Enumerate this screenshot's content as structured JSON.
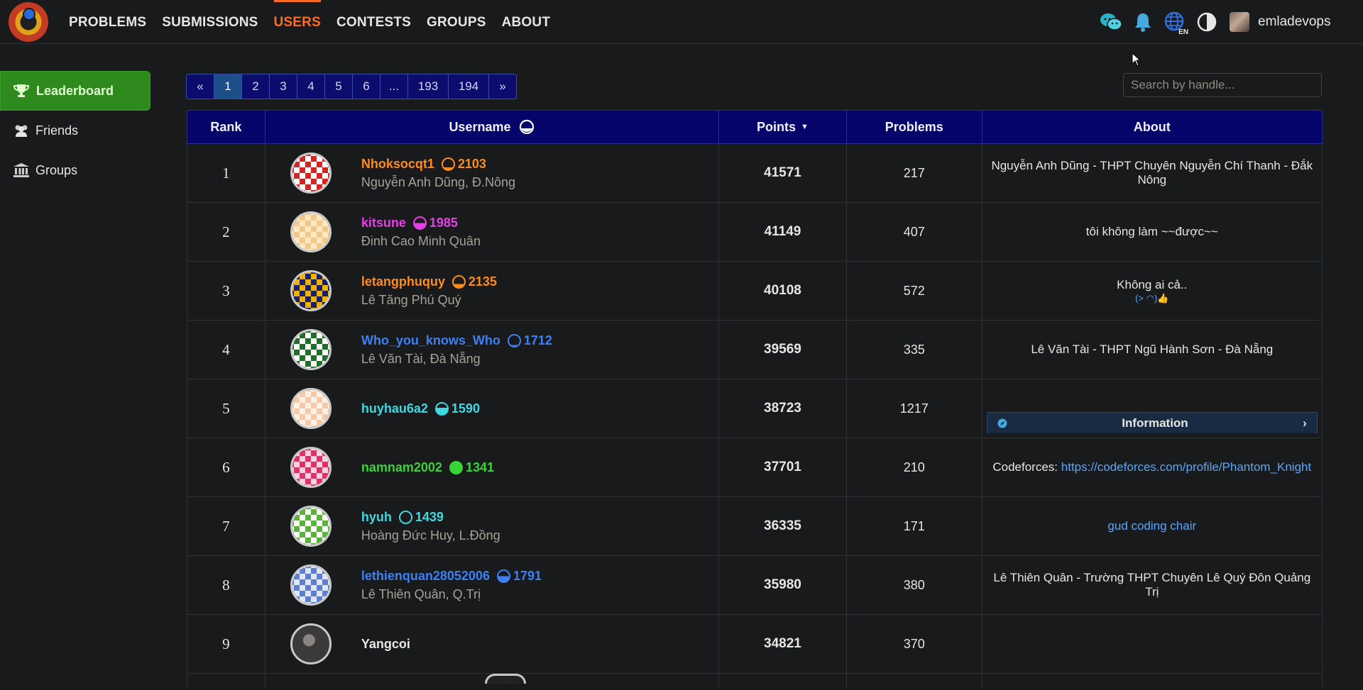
{
  "nav": {
    "items": [
      {
        "label": "PROBLEMS",
        "active": false
      },
      {
        "label": "SUBMISSIONS",
        "active": false
      },
      {
        "label": "USERS",
        "active": true
      },
      {
        "label": "CONTESTS",
        "active": false
      },
      {
        "label": "GROUPS",
        "active": false
      },
      {
        "label": "ABOUT",
        "active": false
      }
    ],
    "lang_badge": "EN",
    "username": "emladevops",
    "icons": [
      "chat-icon",
      "bell-icon",
      "globe-icon",
      "contrast-icon"
    ]
  },
  "sidebar": {
    "items": [
      {
        "label": "Leaderboard",
        "icon": "trophy-icon",
        "active": true
      },
      {
        "label": "Friends",
        "icon": "users-icon",
        "active": false
      },
      {
        "label": "Groups",
        "icon": "institution-icon",
        "active": false
      }
    ]
  },
  "pagination": {
    "prev": "«",
    "pages": [
      "1",
      "2",
      "3",
      "4",
      "5",
      "6",
      "...",
      "193",
      "194"
    ],
    "current": "1",
    "next": "»"
  },
  "search": {
    "placeholder": "Search by handle..."
  },
  "table": {
    "headers": {
      "rank": "Rank",
      "username": "Username",
      "points": "Points",
      "sort_indicator": "▼",
      "problems": "Problems",
      "about": "About"
    },
    "rows": [
      {
        "rank": "1",
        "handle": "Nhoksocqt1",
        "rating": "2103",
        "color": "#ff8c1a",
        "fill": 0.2,
        "fullname": "Nguyễn Anh Dũng, Đ.Nông",
        "points": "41571",
        "problems": "217",
        "about": "Nguyễn Anh Dũng - THPT Chuyên Nguyễn Chí Thanh - Đắk Nông",
        "avatar_colors": [
          "#d42424",
          "#ffffff"
        ]
      },
      {
        "rank": "2",
        "handle": "kitsune",
        "rating": "1985",
        "color": "#e540e5",
        "fill": 0.5,
        "fullname": "Đinh Cao Minh Quân",
        "points": "41149",
        "problems": "407",
        "about": "tôi không làm ~~được~~",
        "avatar_colors": [
          "#f2c98a",
          "#fde8c2"
        ]
      },
      {
        "rank": "3",
        "handle": "letangphuquy",
        "rating": "2135",
        "color": "#ff8c1a",
        "fill": 0.3,
        "fullname": "Lê Tăng Phú Quý",
        "points": "40108",
        "problems": "572",
        "about": "Không ai cả..",
        "about_extra": "(>  ◠)👍",
        "avatar_colors": [
          "#f0b400",
          "#1a1f6e"
        ]
      },
      {
        "rank": "4",
        "handle": "Who_you_knows_Who",
        "rating": "1712",
        "color": "#3d7ff5",
        "fill": 0.1,
        "fullname": "Lê Văn Tài, Đà Nẵng",
        "points": "39569",
        "problems": "335",
        "about": "Lê Văn Tài - THPT Ngũ Hành Sơn - Đà Nẵng",
        "avatar_colors": [
          "#1f6e2a",
          "#ffffff"
        ]
      },
      {
        "rank": "5",
        "handle": "huyhau6a2",
        "rating": "1590",
        "color": "#3dd9e0",
        "fill": 0.6,
        "fullname": "",
        "points": "38723",
        "problems": "1217",
        "about": "",
        "info_label": "Information",
        "avatar_colors": [
          "#f4c9a8",
          "#fdf1e6"
        ]
      },
      {
        "rank": "6",
        "handle": "namnam2002",
        "rating": "1341",
        "color": "#38d438",
        "fill": 1.0,
        "fullname": "",
        "points": "37701",
        "problems": "210",
        "about_prefix": "Codeforces: ",
        "about_link": "https://codeforces.com/profile/Phantom_Knight",
        "avatar_colors": [
          "#e0316a",
          "#ffd1de"
        ]
      },
      {
        "rank": "7",
        "handle": "hyuh",
        "rating": "1439",
        "color": "#3dd9e0",
        "fill": 0.0,
        "fullname": "Hoàng Đức Huy, L.Đồng",
        "points": "36335",
        "problems": "171",
        "about_link": "gud coding chair",
        "avatar_colors": [
          "#5bb33b",
          "#ffffff"
        ]
      },
      {
        "rank": "8",
        "handle": "lethienquan28052006",
        "rating": "1791",
        "color": "#3d7ff5",
        "fill": 0.5,
        "fullname": "Lê Thiên Quân, Q.Trị",
        "points": "35980",
        "problems": "380",
        "about": "Lê Thiên Quân - Trường THPT Chuyên Lê Quý Đôn Quảng Trị",
        "avatar_colors": [
          "#5f7fcf",
          "#dfe6f7"
        ]
      },
      {
        "rank": "9",
        "handle": "Yangcoi",
        "rating": "",
        "color": "#e8e6e3",
        "fill": 0,
        "fullname": "",
        "points": "34821",
        "problems": "370",
        "about": "",
        "avatar_colors": [
          "#3a3a3a",
          "#8a8580"
        ]
      }
    ]
  }
}
